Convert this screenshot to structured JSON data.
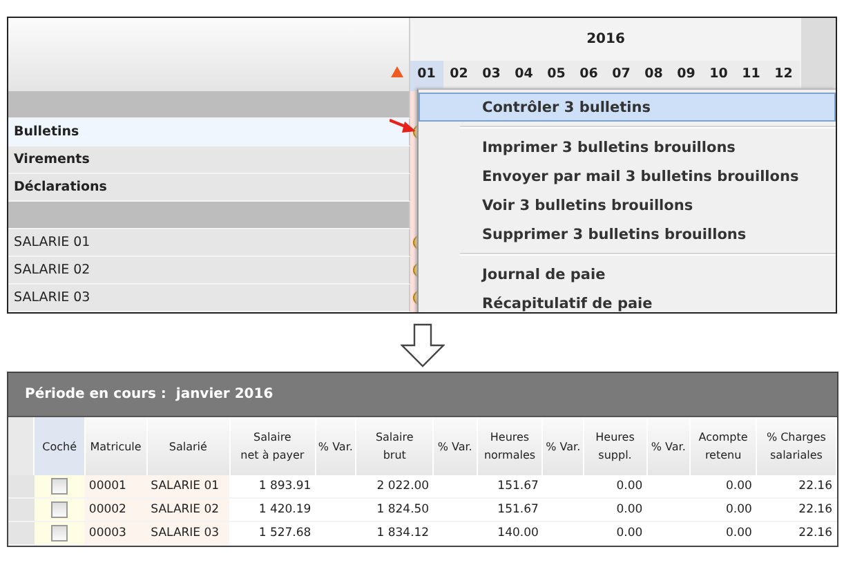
{
  "planning": {
    "year": "2016",
    "months": [
      {
        "label": "01",
        "selected": true
      },
      {
        "label": "02",
        "selected": false
      },
      {
        "label": "03",
        "selected": false
      },
      {
        "label": "04",
        "selected": false
      },
      {
        "label": "05",
        "selected": false
      },
      {
        "label": "06",
        "selected": false
      },
      {
        "label": "07",
        "selected": false
      },
      {
        "label": "08",
        "selected": false
      },
      {
        "label": "09",
        "selected": false
      },
      {
        "label": "10",
        "selected": false
      },
      {
        "label": "11",
        "selected": false
      },
      {
        "label": "12",
        "selected": false
      }
    ],
    "rows": [
      {
        "kind": "group"
      },
      {
        "kind": "item",
        "label": "Bulletins",
        "selected": true,
        "marker": true
      },
      {
        "kind": "item",
        "label": "Virements",
        "selected": false,
        "marker": false
      },
      {
        "kind": "item",
        "label": "Déclarations",
        "selected": false,
        "marker": false
      },
      {
        "kind": "group"
      },
      {
        "kind": "employee",
        "label": "SALARIE 01",
        "selected": false,
        "marker": true
      },
      {
        "kind": "employee",
        "label": "SALARIE 02",
        "selected": false,
        "marker": true
      },
      {
        "kind": "employee",
        "label": "SALARIE 03",
        "selected": false,
        "marker": true
      }
    ],
    "context_menu": [
      {
        "kind": "item",
        "label": "Contrôler 3 bulletins",
        "selected": true
      },
      {
        "kind": "separator"
      },
      {
        "kind": "item",
        "label": "Imprimer 3 bulletins brouillons",
        "selected": false
      },
      {
        "kind": "item",
        "label": "Envoyer par mail 3 bulletins brouillons",
        "selected": false
      },
      {
        "kind": "item",
        "label": "Voir 3 bulletins brouillons",
        "selected": false
      },
      {
        "kind": "item",
        "label": "Supprimer 3 bulletins brouillons",
        "selected": false
      },
      {
        "kind": "separator"
      },
      {
        "kind": "item",
        "label": "Journal de paie",
        "selected": false
      },
      {
        "kind": "item",
        "label": "Récapitulatif de paie",
        "selected": false
      }
    ]
  },
  "payroll": {
    "title": "Période en cours :  janvier 2016",
    "columns": [
      "Coché",
      "Matricule",
      "Salarié",
      "Salaire\nnet à payer",
      "% Var.",
      "Salaire\nbrut",
      "% Var.",
      "Heures\nnormales",
      "% Var.",
      "Heures\nsuppl.",
      "% Var.",
      "Acompte\nretenu",
      "% Charges\nsalariales"
    ],
    "rows": [
      {
        "checked": false,
        "cells": [
          "",
          "00001",
          "SALARIE 01",
          "1 893.91",
          "",
          "2 022.00",
          "",
          "151.67",
          "",
          "0.00",
          "",
          "0.00",
          "22.16"
        ]
      },
      {
        "checked": false,
        "cells": [
          "",
          "00002",
          "SALARIE 02",
          "1 420.19",
          "",
          "1 824.50",
          "",
          "151.67",
          "",
          "0.00",
          "",
          "0.00",
          "22.16"
        ]
      },
      {
        "checked": false,
        "cells": [
          "",
          "00003",
          "SALARIE 03",
          "1 527.68",
          "",
          "1 834.12",
          "",
          "140.00",
          "",
          "0.00",
          "",
          "0.00",
          "22.16"
        ]
      }
    ]
  }
}
